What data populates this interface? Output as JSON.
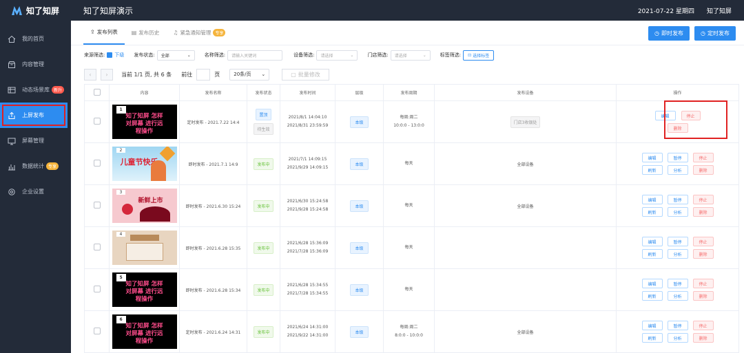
{
  "app": {
    "logo": "知了知屏",
    "title": "知了知屏演示",
    "date": "2021-07-22 星期四",
    "user": "知了知屏"
  },
  "sidebar": {
    "items": [
      {
        "label": "我的首页",
        "icon": "home-icon"
      },
      {
        "label": "内容管理",
        "icon": "box-icon"
      },
      {
        "label": "动态场景库",
        "icon": "table-icon",
        "badge": "新升"
      },
      {
        "label": "上屏发布",
        "icon": "upload-icon",
        "active": true
      },
      {
        "label": "屏幕管理",
        "icon": "monitor-icon"
      },
      {
        "label": "数据统计",
        "icon": "chart-icon",
        "badge": "专享"
      },
      {
        "label": "企业设置",
        "icon": "settings-icon"
      }
    ]
  },
  "tabs": [
    {
      "label": "发布列表",
      "icon": "upload-icon"
    },
    {
      "label": "发布历史",
      "icon": "history-icon"
    },
    {
      "label": "紧急通知管理",
      "icon": "bell-icon",
      "badge": "专享"
    }
  ],
  "buttons": {
    "instant": "即时发布",
    "scheduled": "定时发布"
  },
  "filters": {
    "source_label": "来源筛选:",
    "source_value": "下级",
    "status_label": "发布状态:",
    "status_value": "全部",
    "name_label": "名称筛选:",
    "name_placeholder": "请输入关键词",
    "device_label": "设备筛选:",
    "device_placeholder": "请选择",
    "store_label": "门店筛选:",
    "store_placeholder": "请选择",
    "tag_label": "标签筛选:",
    "tag_button": "选择标签"
  },
  "pager": {
    "info": "当前 1/1 页, 共 6 条",
    "goto": "前往",
    "page_unit": "页",
    "per_page": "20条/页",
    "batch": "批量修改"
  },
  "table": {
    "headers": [
      "内容",
      "发布名称",
      "发布状态",
      "发布时间",
      "层级",
      "发布周期",
      "发布设备",
      "操作"
    ],
    "rows": [
      {
        "num": "1",
        "thumb": "black",
        "thumb_text": "知了知屏 怎样对屏幕 进行远程操作",
        "name": "定时发布 - 2021.7.22 14:4",
        "status": [
          "置顶",
          "待生效"
        ],
        "time": [
          "2021/8/1 14:04:10",
          "2021/8/31 23:59:59"
        ],
        "level": "本级",
        "cycle": [
          "每周:周二",
          "10:0:0 - 13:0:0"
        ],
        "device": "门店3收银处",
        "ops": [
          "编辑",
          "停止",
          "删除"
        ]
      },
      {
        "num": "2",
        "thumb": "festival",
        "thumb_text": "儿童节快乐",
        "name": "即时发布 - 2021.7.1 14:9",
        "status": [
          "发布中"
        ],
        "time": [
          "2021/7/1 14:09:15",
          "2021/9/29 14:09:15"
        ],
        "level": "本级",
        "cycle": [
          "每天"
        ],
        "device": "全部设备",
        "ops": [
          "编辑",
          "暂停",
          "停止",
          "刷新",
          "分析",
          "删除"
        ]
      },
      {
        "num": "3",
        "thumb": "cherry",
        "thumb_text": "新鲜上市",
        "name": "即时发布 - 2021.6.30 15:24",
        "status": [
          "发布中"
        ],
        "time": [
          "2021/6/30 15:24:58",
          "2021/9/28 15:24:58"
        ],
        "level": "本级",
        "cycle": [
          "每天"
        ],
        "device": "全部设备",
        "ops": [
          "编辑",
          "暂停",
          "停止",
          "刷新",
          "分析",
          "删除"
        ]
      },
      {
        "num": "4",
        "thumb": "shop",
        "thumb_text": "",
        "name": "即时发布 - 2021.6.28 15:35",
        "status": [
          "发布中"
        ],
        "time": [
          "2021/6/28 15:36:09",
          "2021/7/28 15:36:09"
        ],
        "level": "本级",
        "cycle": [
          "每天"
        ],
        "device": "",
        "ops": [
          "编辑",
          "暂停",
          "停止",
          "刷新",
          "分析",
          "删除"
        ]
      },
      {
        "num": "5",
        "thumb": "black",
        "thumb_text": "知了知屏 怎样对屏幕 进行远程操作",
        "name": "即时发布 - 2021.6.28 15:34",
        "status": [
          "发布中"
        ],
        "time": [
          "2021/6/28 15:34:55",
          "2021/7/28 15:34:55"
        ],
        "level": "本级",
        "cycle": [
          "每天"
        ],
        "device": "",
        "ops": [
          "编辑",
          "暂停",
          "停止",
          "刷新",
          "分析",
          "删除"
        ]
      },
      {
        "num": "6",
        "thumb": "black",
        "thumb_text": "知了知屏 怎样对屏幕 进行远程操作",
        "name": "定时发布 - 2021.6.24 14:31",
        "status": [
          "发布中"
        ],
        "time": [
          "2021/6/24 14:31:00",
          "2021/9/22 14:31:00"
        ],
        "level": "本级",
        "cycle": [
          "每周:周二",
          "8:0:0 - 10:0:0"
        ],
        "device": "全部设备",
        "ops": [
          "编辑",
          "暂停",
          "停止",
          "刷新",
          "分析",
          "删除"
        ]
      }
    ]
  }
}
